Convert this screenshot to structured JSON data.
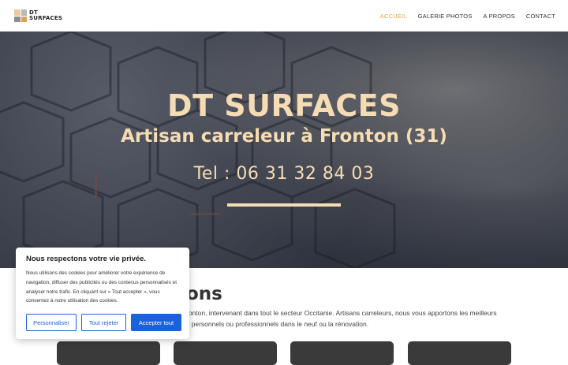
{
  "header": {
    "logo_line1": "DT",
    "logo_line2": "SURFACES",
    "logo_colors": [
      "#e8c9a0",
      "#b9b9b9",
      "#8e8e8e",
      "#d9a35a"
    ],
    "nav": [
      {
        "label": "ACCUEIL",
        "active": true
      },
      {
        "label": "GALERIE PHOTOS",
        "active": false
      },
      {
        "label": "A PROPOS",
        "active": false
      },
      {
        "label": "CONTACT",
        "active": false
      }
    ],
    "active_color": "#e0a93b"
  },
  "hero": {
    "title": "DT SURFACES",
    "subtitle": "Artisan carreleur à Fronton (31)",
    "phone": "Tel : 06 31 32 84 03",
    "text_color": "#f6dcb5"
  },
  "main": {
    "section_title_visible": "ons",
    "intro_line1": "ronton, intervenant dans tout le secteur Occitanie.  Artisans carreleurs, nous vous apportons les meilleurs",
    "intro_line2": "s personnels ou professionnels dans le neuf ou la rénovation."
  },
  "cookie_banner": {
    "title": "Nous respectons votre vie privée.",
    "text": "Nous utilisons des cookies pour améliorer votre expérience de navigation, diffuser des publicités ou des contenus personnalisés et analyser notre trafic. En cliquant sur « Tout accepter », vous consentez à notre utilisation des cookies.",
    "btn_customize": "Personnaliser",
    "btn_reject": "Tout rejeter",
    "btn_accept": "Accepter tout",
    "accent": "#1863dc"
  }
}
